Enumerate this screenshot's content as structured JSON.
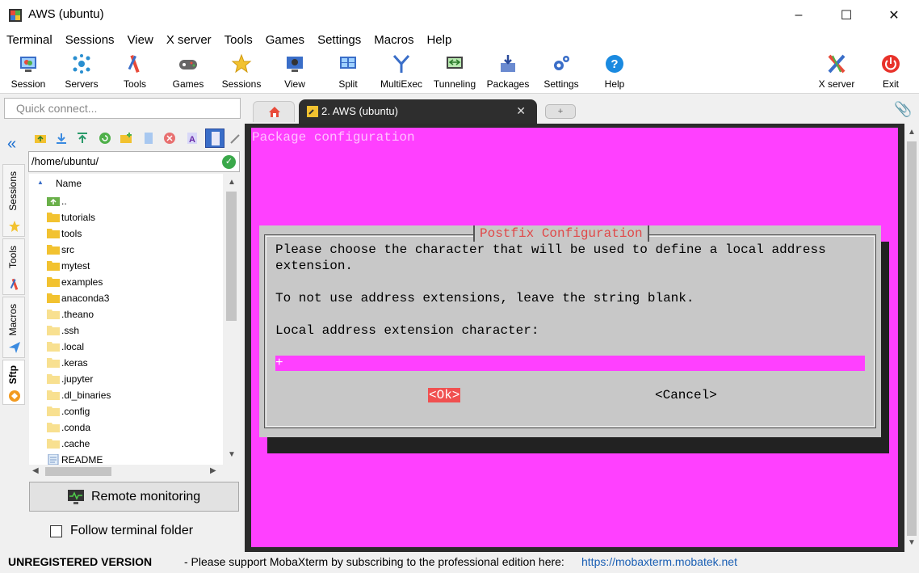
{
  "window": {
    "title": "AWS (ubuntu)",
    "minimize": "–",
    "maximize": "☐",
    "close": "✕"
  },
  "menu": [
    "Terminal",
    "Sessions",
    "View",
    "X server",
    "Tools",
    "Games",
    "Settings",
    "Macros",
    "Help"
  ],
  "toolbar": {
    "session": "Session",
    "servers": "Servers",
    "tools": "Tools",
    "games": "Games",
    "sessions": "Sessions",
    "view": "View",
    "split": "Split",
    "multiexec": "MultiExec",
    "tunneling": "Tunneling",
    "packages": "Packages",
    "settings": "Settings",
    "help": "Help",
    "xserver": "X server",
    "exit": "Exit"
  },
  "quick_connect": {
    "placeholder": "Quick connect..."
  },
  "tabs": {
    "active_label": "2. AWS (ubuntu)",
    "close": "✕",
    "new_tab": "+"
  },
  "side_tabs": {
    "collapse": "«",
    "sessions": "Sessions",
    "tools": "Tools",
    "macros": "Macros",
    "sftp": "Sftp"
  },
  "sftp": {
    "path": "/home/ubuntu/",
    "path_ok": "✓",
    "column_name": "Name",
    "sort_indicator": "▲",
    "files": [
      {
        "name": "..",
        "type": "parent"
      },
      {
        "name": "tutorials",
        "type": "folder"
      },
      {
        "name": "tools",
        "type": "folder"
      },
      {
        "name": "src",
        "type": "folder"
      },
      {
        "name": "mytest",
        "type": "folder"
      },
      {
        "name": "examples",
        "type": "folder"
      },
      {
        "name": "anaconda3",
        "type": "folder"
      },
      {
        "name": ".theano",
        "type": "hidden-folder"
      },
      {
        "name": ".ssh",
        "type": "hidden-folder"
      },
      {
        "name": ".local",
        "type": "hidden-folder"
      },
      {
        "name": ".keras",
        "type": "hidden-folder"
      },
      {
        "name": ".jupyter",
        "type": "hidden-folder"
      },
      {
        "name": ".dl_binaries",
        "type": "hidden-folder"
      },
      {
        "name": ".config",
        "type": "hidden-folder"
      },
      {
        "name": ".conda",
        "type": "hidden-folder"
      },
      {
        "name": ".cache",
        "type": "hidden-folder"
      },
      {
        "name": "README",
        "type": "file"
      }
    ],
    "remote_monitoring": "Remote monitoring",
    "follow_terminal": "Follow terminal folder",
    "follow_checked": false
  },
  "terminal": {
    "header": "Package configuration",
    "dialog_title": "Postfix Configuration",
    "lines": [
      "Please choose the character that will be used to define a local address",
      "extension.",
      "To not use address extensions, leave the string blank.",
      "Local address extension character:"
    ],
    "input_value": "+",
    "ok_button": "<Ok>",
    "cancel_button": "<Cancel>"
  },
  "status": {
    "unregistered": "UNREGISTERED VERSION",
    "message": "-  Please support MobaXterm by subscribing to the professional edition here:",
    "link": "https://mobaxterm.mobatek.net"
  },
  "colors": {
    "terminal_bg": "#ff40ff",
    "dialog_bg": "#c8c8c8",
    "ok_bg": "#f05050",
    "dialog_title": "#e04848",
    "tab_active": "#2e2e2e",
    "link": "#1a5fb4"
  }
}
